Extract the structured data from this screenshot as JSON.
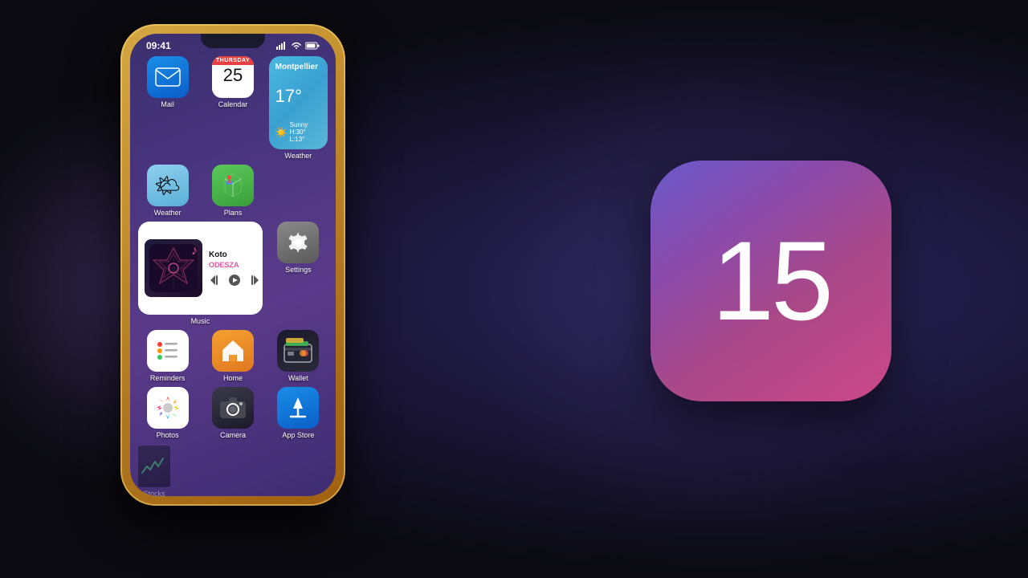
{
  "background": {
    "color": "#0a0a0f"
  },
  "status_bar": {
    "time": "09:41",
    "signal": "●●●",
    "wifi": "wifi",
    "battery": "battery"
  },
  "apps": {
    "row1": [
      {
        "id": "mail",
        "label": "Mail",
        "icon_type": "mail"
      },
      {
        "id": "calendar",
        "label": "Calendar",
        "icon_type": "calendar",
        "day_name": "THURSDAY",
        "date": "25"
      },
      {
        "id": "weather_widget",
        "label": "Weather",
        "icon_type": "weather_widget",
        "city": "Montpellier",
        "temp": "17°",
        "condition": "Sunny",
        "high_low": "H:30° L:13°"
      }
    ],
    "row2": [
      {
        "id": "weather",
        "label": "Weather",
        "icon_type": "weather_small"
      },
      {
        "id": "plans",
        "label": "Plans",
        "icon_type": "maps"
      }
    ],
    "row3": [
      {
        "id": "music",
        "label": "Music",
        "icon_type": "music_widget",
        "track": "Koto",
        "artist": "ODESZA"
      },
      {
        "id": "settings",
        "label": "Settings",
        "icon_type": "settings"
      },
      {
        "id": "reminders",
        "label": "Reminders",
        "icon_type": "reminders"
      }
    ],
    "row4": [
      {
        "id": "home",
        "label": "Home",
        "icon_type": "home"
      },
      {
        "id": "wallet",
        "label": "Wallet",
        "icon_type": "wallet"
      }
    ],
    "bottom": [
      {
        "id": "photos",
        "label": "Photos",
        "icon_type": "photos"
      },
      {
        "id": "camera",
        "label": "Camera",
        "icon_type": "camera"
      },
      {
        "id": "appstore",
        "label": "App Store",
        "icon_type": "appstore"
      },
      {
        "id": "stocks",
        "label": "Stocks",
        "icon_type": "stocks"
      }
    ]
  },
  "ios15": {
    "number": "15"
  }
}
